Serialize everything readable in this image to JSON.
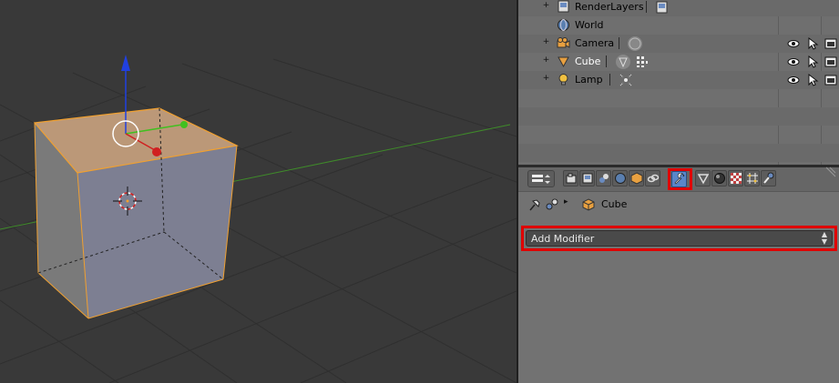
{
  "outliner": {
    "items": [
      {
        "label": "RenderLayers",
        "expander": "+",
        "icon": "render-layers-icon"
      },
      {
        "label": "World",
        "expander": "",
        "icon": "world-icon"
      },
      {
        "label": "Camera",
        "expander": "+",
        "icon": "camera-object-icon"
      },
      {
        "label": "Cube",
        "expander": "+",
        "icon": "mesh-object-icon"
      },
      {
        "label": "Lamp",
        "expander": "+",
        "icon": "lamp-object-icon"
      }
    ]
  },
  "properties": {
    "tabs": [
      "render-icon",
      "render-layers-icon",
      "scene-icon",
      "world-icon",
      "object-icon",
      "constraints-icon",
      "modifiers-wrench-icon",
      "data-mesh-icon",
      "material-icon",
      "texture-icon",
      "particles-icon",
      "physics-icon"
    ],
    "active_tab": "modifiers-wrench-icon",
    "breadcrumb": {
      "object_name": "Cube"
    },
    "add_modifier_label": "Add Modifier"
  },
  "colors": {
    "highlight": "#e00000",
    "selection_orange": "#f0a030",
    "axis_x": "#d02020",
    "axis_y": "#40c020",
    "axis_z": "#2040e0"
  }
}
